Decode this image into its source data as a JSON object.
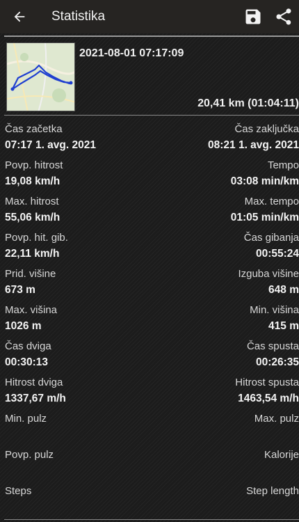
{
  "header": {
    "title": "Statistika",
    "icons": {
      "back": "arrow-left-icon",
      "save": "save-icon",
      "share": "share-icon"
    }
  },
  "summary": {
    "datetime": "2021-08-01 07:17:09",
    "distance": "20,41 km (01:04:11)"
  },
  "stats": [
    {
      "left": {
        "label": "Čas začetka",
        "value": "07:17 1. avg. 2021"
      },
      "right": {
        "label": "Čas zaključka",
        "value": "08:21 1. avg. 2021"
      }
    },
    {
      "left": {
        "label": "Povp. hitrost",
        "value": "19,08 km/h"
      },
      "right": {
        "label": "Tempo",
        "value": "03:08 min/km"
      }
    },
    {
      "left": {
        "label": "Max. hitrost",
        "value": "55,06 km/h"
      },
      "right": {
        "label": "Max. tempo",
        "value": "01:05 min/km"
      }
    },
    {
      "left": {
        "label": "Povp. hit. gib.",
        "value": "22,11 km/h"
      },
      "right": {
        "label": "Čas gibanja",
        "value": "00:55:24"
      }
    },
    {
      "left": {
        "label": "Prid. višine",
        "value": "673 m"
      },
      "right": {
        "label": "Izguba višine",
        "value": "648 m"
      }
    },
    {
      "left": {
        "label": "Max. višina",
        "value": "1026 m"
      },
      "right": {
        "label": "Min. višina",
        "value": "415 m"
      }
    },
    {
      "left": {
        "label": "Čas dviga",
        "value": "00:30:13"
      },
      "right": {
        "label": "Čas spusta",
        "value": "00:26:35"
      }
    },
    {
      "left": {
        "label": "Hitrost dviga",
        "value": "1337,67 m/h"
      },
      "right": {
        "label": "Hitrost spusta",
        "value": "1463,54 m/h"
      }
    },
    {
      "left": {
        "label": "Min. pulz",
        "value": ""
      },
      "right": {
        "label": "Max. pulz",
        "value": ""
      }
    },
    {
      "left": {
        "label": "Povp. pulz",
        "value": ""
      },
      "right": {
        "label": "Kalorije",
        "value": ""
      }
    },
    {
      "left": {
        "label": "Steps",
        "value": ""
      },
      "right": {
        "label": "Step length",
        "value": ""
      }
    }
  ],
  "colors": {
    "appbar": "#262422",
    "background": "#1c1c1c",
    "route": "#1f3fd0"
  }
}
